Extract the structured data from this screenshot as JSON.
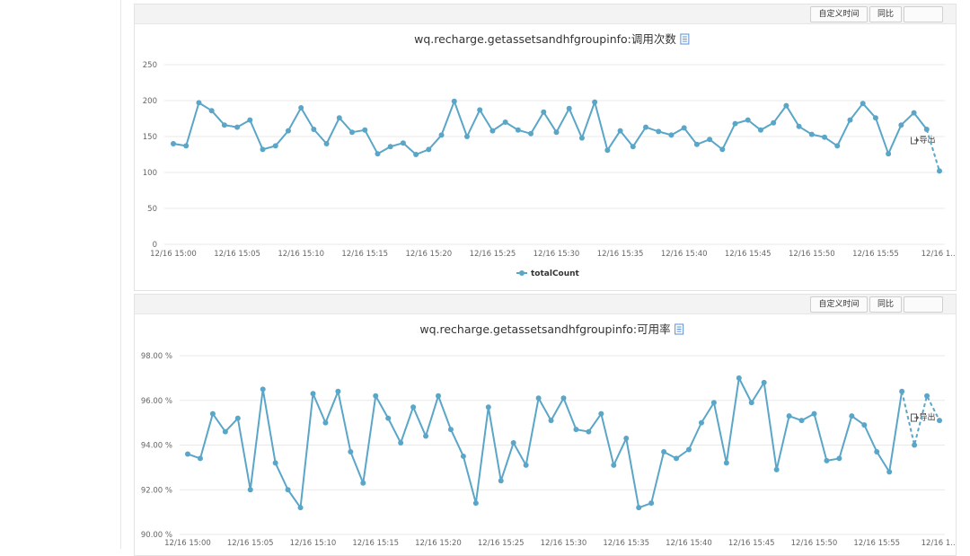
{
  "toolbar": {
    "custom_time": "自定义时间",
    "yoy": "同比",
    "export": "导出"
  },
  "colors": {
    "series": "#5aa6c8",
    "grid": "#e9e9e9",
    "axis_text": "#666666",
    "title": "#333333",
    "doc_icon": "#5b8fd3"
  },
  "legend_icon": "doc-icon",
  "chart_data": [
    {
      "type": "line",
      "title": "wq.recharge.getassetsandhfgroupinfo:调用次数",
      "x_tick_labels": [
        "12/16 15:00",
        "12/16 15:05",
        "12/16 15:10",
        "12/16 15:15",
        "12/16 15:20",
        "12/16 15:25",
        "12/16 15:30",
        "12/16 15:35",
        "12/16 15:40",
        "12/16 15:45",
        "12/16 15:50",
        "12/16 15:55",
        "12/16 1..."
      ],
      "ylim": [
        0,
        250
      ],
      "y_ticks": [
        0,
        50,
        100,
        150,
        200,
        250
      ],
      "grid": true,
      "legend_position": "bottom-center",
      "dashed_from_index": 60,
      "series": [
        {
          "name": "totalCount",
          "values": [
            140,
            137,
            197,
            186,
            166,
            163,
            173,
            132,
            137,
            158,
            190,
            160,
            140,
            176,
            156,
            159,
            126,
            136,
            141,
            125,
            132,
            152,
            199,
            150,
            187,
            158,
            170,
            159,
            154,
            184,
            156,
            189,
            148,
            198,
            131,
            158,
            136,
            163,
            157,
            152,
            162,
            139,
            146,
            132,
            168,
            173,
            159,
            169,
            193,
            164,
            153,
            149,
            137,
            173,
            196,
            176,
            126,
            166,
            183,
            160,
            102
          ]
        }
      ]
    },
    {
      "type": "line",
      "title": "wq.recharge.getassetsandhfgroupinfo:可用率",
      "x_tick_labels": [
        "12/16 15:00",
        "12/16 15:05",
        "12/16 15:10",
        "12/16 15:15",
        "12/16 15:20",
        "12/16 15:25",
        "12/16 15:30",
        "12/16 15:35",
        "12/16 15:40",
        "12/16 15:45",
        "12/16 15:50",
        "12/16 15:55",
        "12/16 1..."
      ],
      "y_tick_labels": [
        "90.00 %",
        "92.00 %",
        "94.00 %",
        "96.00 %",
        "98.00 %"
      ],
      "ylim": [
        90,
        98
      ],
      "grid": true,
      "dashed_from_index": 58,
      "series": [
        {
          "name": "",
          "values": [
            93.6,
            93.4,
            95.4,
            94.6,
            95.2,
            92.0,
            96.5,
            93.2,
            92.0,
            91.2,
            96.3,
            95.0,
            96.4,
            93.7,
            92.3,
            96.2,
            95.2,
            94.1,
            95.7,
            94.4,
            96.2,
            94.7,
            93.5,
            91.4,
            95.7,
            92.4,
            94.1,
            93.1,
            96.1,
            95.1,
            96.1,
            94.7,
            94.6,
            95.4,
            93.1,
            94.3,
            91.2,
            91.4,
            93.7,
            93.4,
            93.8,
            95.0,
            95.9,
            93.2,
            97.0,
            95.9,
            96.8,
            92.9,
            95.3,
            95.1,
            95.4,
            93.3,
            93.4,
            95.3,
            94.9,
            93.7,
            92.8,
            96.4,
            94.0,
            96.2,
            95.1
          ]
        }
      ]
    }
  ]
}
